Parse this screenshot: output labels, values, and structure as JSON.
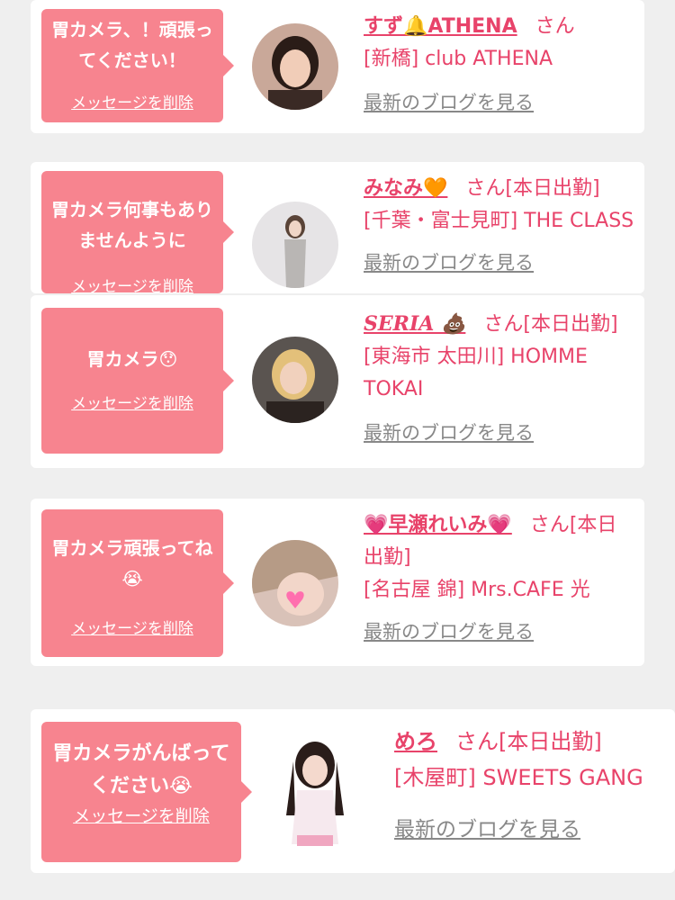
{
  "colors": {
    "accent": "#e8436a",
    "bubble": "#f7848f",
    "link_gray": "#888888",
    "background": "#efefef"
  },
  "delete_label": "メッセージを削除",
  "blog_label": "最新のブログを見る",
  "cards": [
    {
      "message": "胃カメラ、！頑張ってください！",
      "name": "すず🔔ATHENA",
      "san": "さん",
      "status": "",
      "shop": "[新橋] club ATHENA",
      "avatar_icon": "woman-portrait-icon"
    },
    {
      "message": "胃カメラ何事もありませんように",
      "name": "みなみ🧡",
      "san": "さん",
      "status": "[本日出勤]",
      "shop": "[千葉・富士見町] THE CLASS",
      "avatar_icon": "woman-portrait-icon"
    },
    {
      "message": "胃カメラ😯",
      "name": "SERIA 💩",
      "san": "さん",
      "status": "[本日出勤]",
      "shop": "[東海市 太田川] HOMME TOKAI",
      "avatar_icon": "woman-portrait-icon"
    },
    {
      "message": "胃カメラ頑張ってね😭",
      "name": "💗早瀬れいみ💗",
      "san": "さん",
      "status": "[本日出勤]",
      "shop": "[名古屋 錦] Mrs.CAFE 光",
      "avatar_icon": "woman-portrait-icon"
    },
    {
      "message": "胃カメラがんばってください😭",
      "name": "めろ",
      "san": "さん",
      "status": "[本日出勤]",
      "shop": "[木屋町] SWEETS GANG",
      "avatar_icon": "woman-portrait-icon"
    }
  ]
}
